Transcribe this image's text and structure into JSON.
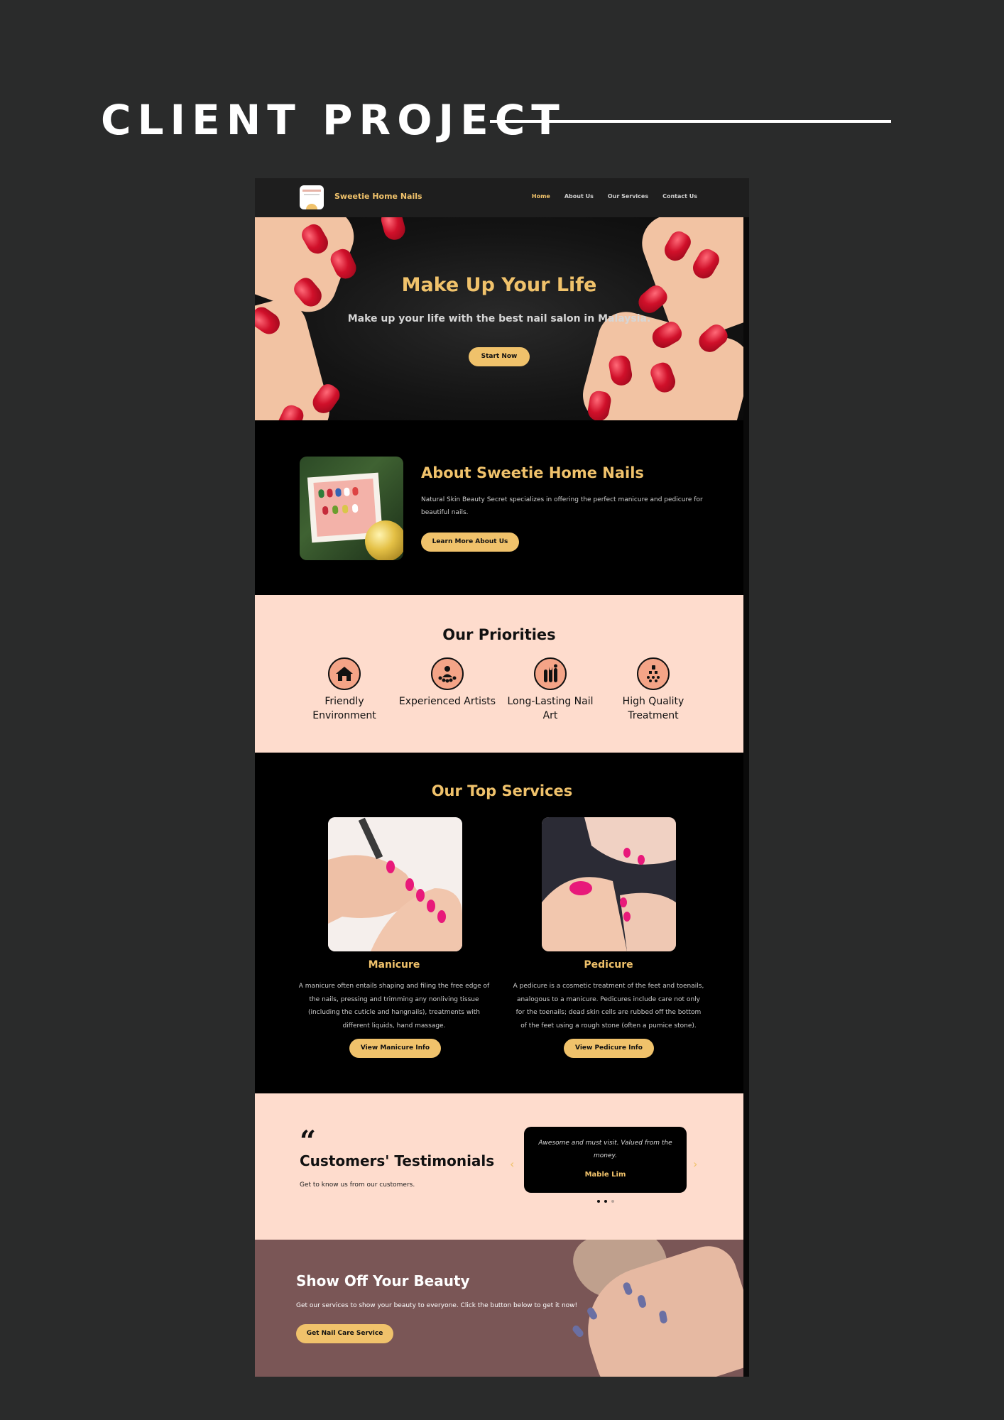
{
  "header": {
    "title": "CLIENT PROJECT"
  },
  "nav": {
    "brand": "Sweetie Home Nails",
    "links": [
      "Home",
      "About Us",
      "Our Services",
      "Contact Us"
    ],
    "active": "Home"
  },
  "hero": {
    "title": "Make Up Your Life",
    "subtitle": "Make up your life with the best nail salon in Malaysia.",
    "button": "Start Now"
  },
  "about": {
    "title": "About Sweetie Home Nails",
    "text": "Natural Skin Beauty Secret specializes in offering the perfect manicure and pedicure for beautiful nails.",
    "button": "Learn More About Us"
  },
  "priorities": {
    "title": "Our Priorities",
    "items": [
      {
        "label": "Friendly Environment",
        "icon": "house-icon"
      },
      {
        "label": "Experienced Artists",
        "icon": "artist-icon"
      },
      {
        "label": "Long-Lasting Nail Art",
        "icon": "nail-art-icon"
      },
      {
        "label": "High Quality Treatment",
        "icon": "quality-icon"
      }
    ]
  },
  "services": {
    "title": "Our Top Services",
    "items": [
      {
        "name": "Manicure",
        "desc": "A manicure often entails shaping and filing the free edge of the nails, pressing and trimming any nonliving tissue (including the cuticle and hangnails), treatments with different liquids, hand massage.",
        "button": "View Manicure Info"
      },
      {
        "name": "Pedicure",
        "desc": "A pedicure is a cosmetic treatment of the feet and toenails, analogous to a manicure. Pedicures include care not only for the toenails; dead skin cells are rubbed off the bottom of the feet using a rough stone (often a pumice stone).",
        "button": "View Pedicure Info"
      }
    ]
  },
  "testimonials": {
    "title": "Customers' Testimonials",
    "subtitle": "Get to know us from our customers.",
    "quote": "Awesome and must visit. Valued from the money.",
    "author": "Mable Lim",
    "prev": "‹",
    "next": "›"
  },
  "cta": {
    "title": "Show Off Your Beauty",
    "text": "Get our services to show your beauty to everyone. Click the button below to get it now!",
    "button": "Get Nail Care Service"
  },
  "colors": {
    "accent": "#f0c26b",
    "peach": "#fedccd",
    "background": "#2a2b2b"
  }
}
